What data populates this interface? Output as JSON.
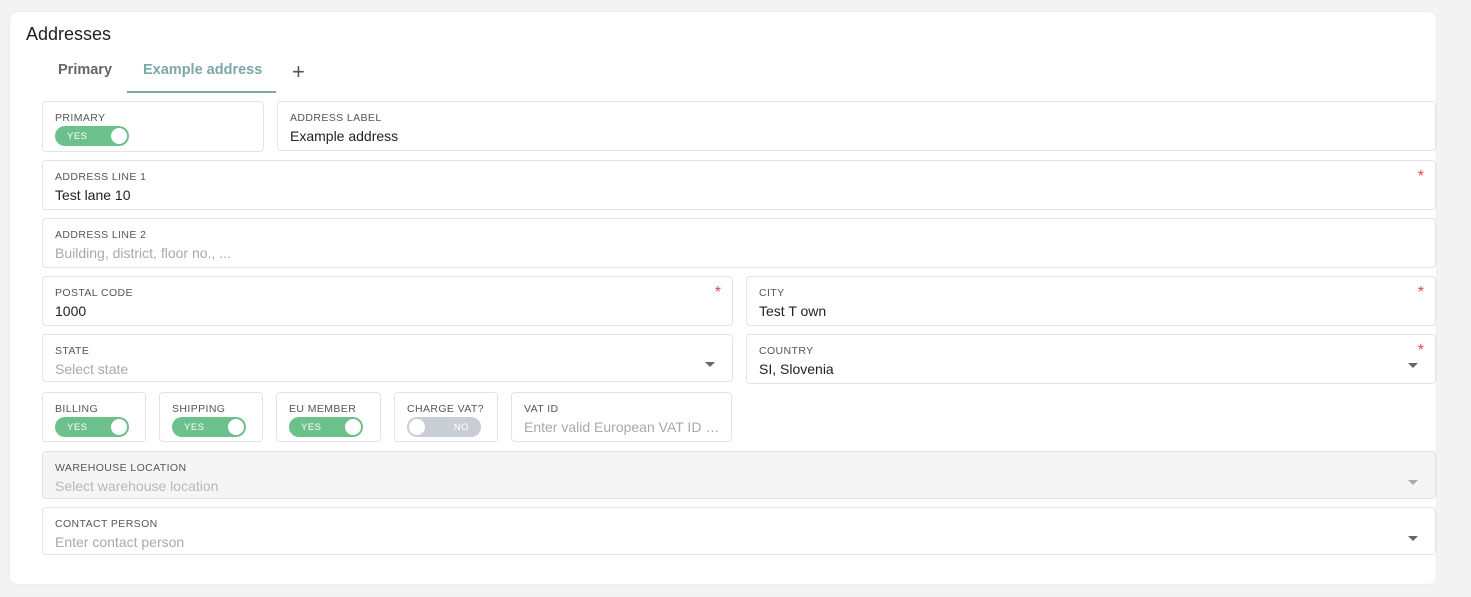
{
  "section": {
    "title": "Addresses"
  },
  "tabs": [
    {
      "label": "Primary"
    },
    {
      "label": "Example address"
    }
  ],
  "form": {
    "primary": {
      "label": "PRIMARY",
      "toggle_text": "YES"
    },
    "address_label": {
      "label": "ADDRESS LABEL",
      "value": "Example address"
    },
    "address_line1": {
      "label": "ADDRESS LINE 1",
      "value": "Test lane 10",
      "required_mark": "*"
    },
    "address_line2": {
      "label": "ADDRESS LINE 2",
      "placeholder": "Building, district, floor no., ..."
    },
    "postal_code": {
      "label": "POSTAL CODE",
      "value": "1000",
      "required_mark": "*"
    },
    "city": {
      "label": "CITY",
      "value": "Test T own",
      "required_mark": "*"
    },
    "state": {
      "label": "STATE",
      "placeholder": "Select state"
    },
    "country": {
      "label": "COUNTRY",
      "value": "SI, Slovenia",
      "required_mark": "*"
    },
    "billing": {
      "label": "BILLING",
      "toggle_text": "YES"
    },
    "shipping": {
      "label": "SHIPPING",
      "toggle_text": "YES"
    },
    "eu_member": {
      "label": "EU MEMBER",
      "toggle_text": "YES"
    },
    "charge_vat": {
      "label": "CHARGE VAT?",
      "toggle_text": "NO"
    },
    "vat_id": {
      "label": "VAT ID",
      "placeholder": "Enter valid European VAT ID n..."
    },
    "warehouse_location": {
      "label": "WAREHOUSE LOCATION",
      "placeholder": "Select warehouse location"
    },
    "contact_person": {
      "label": "CONTACT PERSON",
      "placeholder": "Enter contact person"
    }
  },
  "colors": {
    "accent": "#7aa8a8",
    "toggle_on": "#6cc08b",
    "toggle_off": "#c9cdd6",
    "required": "#e04b4b"
  },
  "icons": {
    "add_tab": "plus-icon",
    "dropdown": "caret-down-icon"
  }
}
